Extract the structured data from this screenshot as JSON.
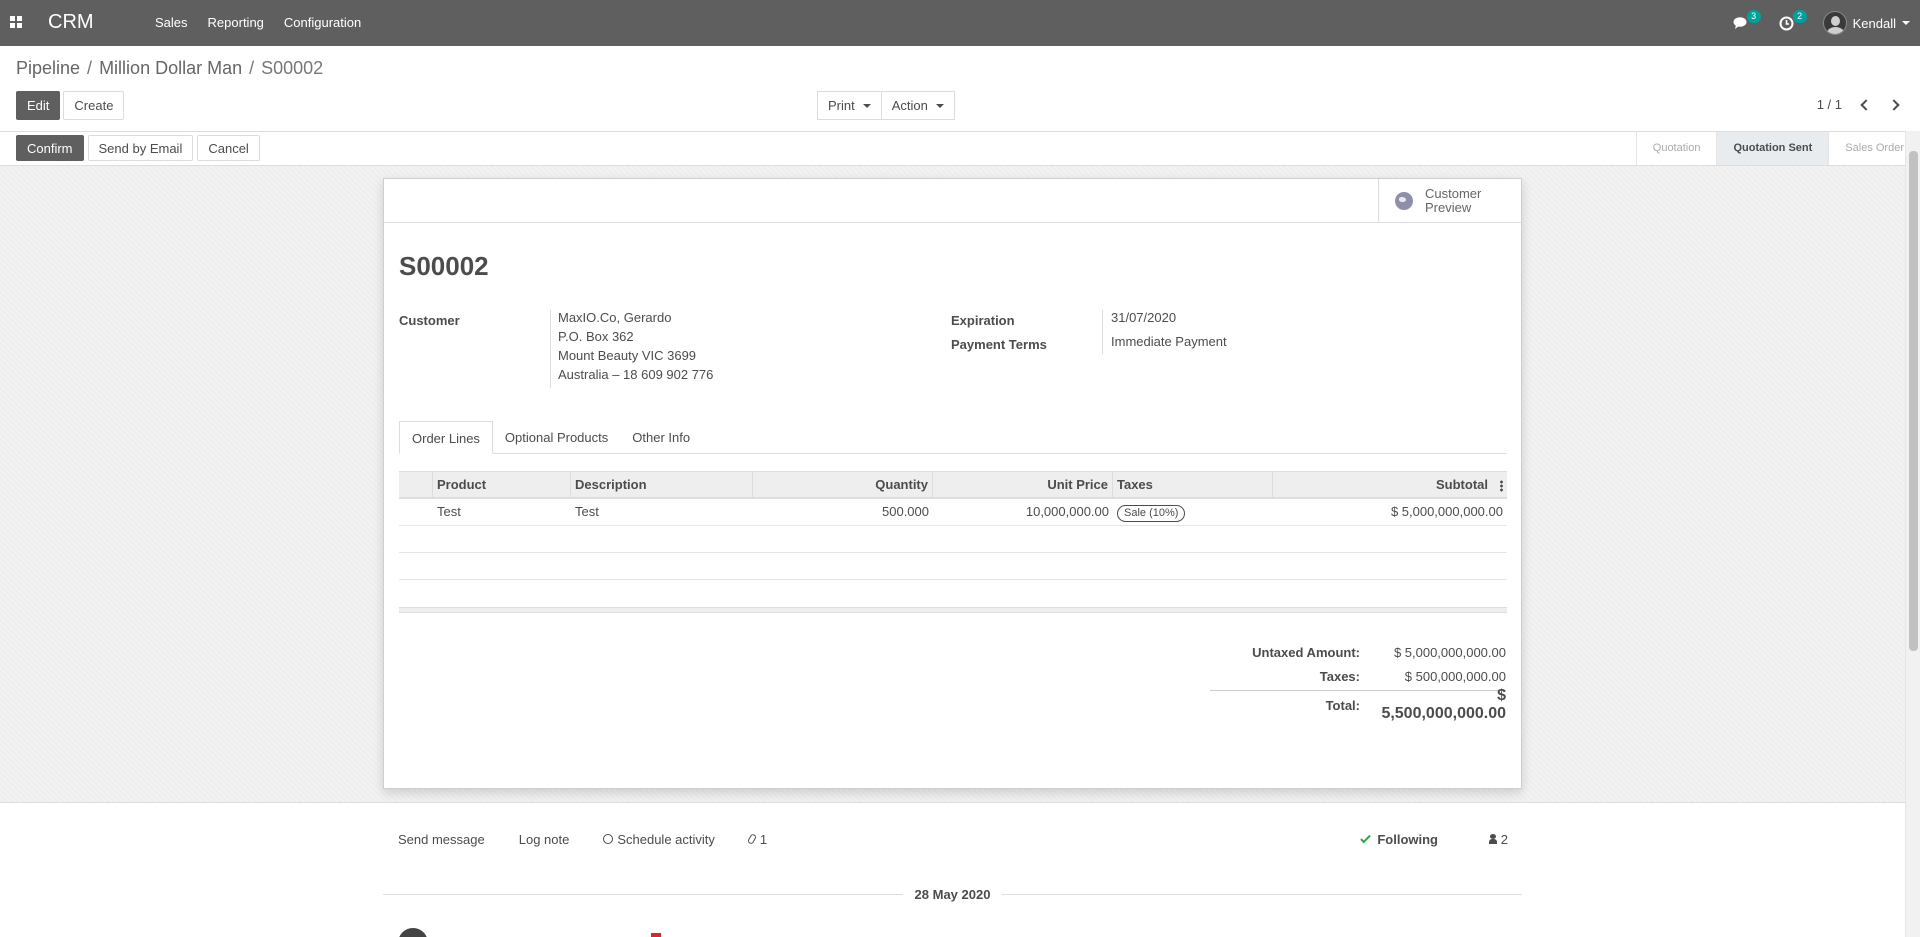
{
  "navbar": {
    "brand": "CRM",
    "menu": [
      "Sales",
      "Reporting",
      "Configuration"
    ],
    "messages_badge": "3",
    "activities_badge": "2",
    "user": "Kendall"
  },
  "breadcrumb": {
    "items": [
      "Pipeline",
      "Million Dollar Man"
    ],
    "active": "S00002"
  },
  "toolbar": {
    "edit": "Edit",
    "create": "Create",
    "print": "Print",
    "action": "Action",
    "pager": "1 / 1"
  },
  "status_buttons": {
    "confirm": "Confirm",
    "send_by_email": "Send by Email",
    "cancel": "Cancel"
  },
  "stages": [
    {
      "label": "Quotation",
      "active": false
    },
    {
      "label": "Quotation Sent",
      "active": true
    },
    {
      "label": "Sales Order",
      "active": false
    }
  ],
  "sheet": {
    "customer_preview": "Customer Preview",
    "name": "S00002",
    "customer_label": "Customer",
    "customer_lines": [
      "MaxIO.Co, Gerardo",
      "P.O. Box 362",
      "Mount Beauty VIC 3699",
      "Australia – 18 609 902 776"
    ],
    "expiration_label": "Expiration",
    "expiration_value": "31/07/2020",
    "payment_terms_label": "Payment Terms",
    "payment_terms_value": "Immediate Payment",
    "tabs": [
      {
        "label": "Order Lines",
        "active": true
      },
      {
        "label": "Optional Products",
        "active": false
      },
      {
        "label": "Other Info",
        "active": false
      }
    ],
    "table_headers": {
      "product": "Product",
      "description": "Description",
      "quantity": "Quantity",
      "unit_price": "Unit Price",
      "taxes": "Taxes",
      "subtotal": "Subtotal"
    },
    "lines": [
      {
        "product": "Test",
        "description": "Test",
        "quantity": "500.000",
        "unit_price": "10,000,000.00",
        "tax": "Sale (10%)",
        "subtotal": "$ 5,000,000,000.00"
      }
    ],
    "totals": {
      "untaxed_label": "Untaxed Amount:",
      "untaxed_value": "$ 5,000,000,000.00",
      "taxes_label": "Taxes:",
      "taxes_value": "$ 500,000,000.00",
      "total_label": "Total:",
      "total_value": "$ 5,500,000,000.00"
    }
  },
  "chatter": {
    "send_message": "Send message",
    "log_note": "Log note",
    "schedule_activity": "Schedule activity",
    "attachments": "1",
    "following": "Following",
    "followers": "2",
    "date": "28 May 2020"
  },
  "colors": {
    "navbar": "#5f5f5f",
    "accent_badge": "#00a09d",
    "following_check": "#28a745"
  }
}
